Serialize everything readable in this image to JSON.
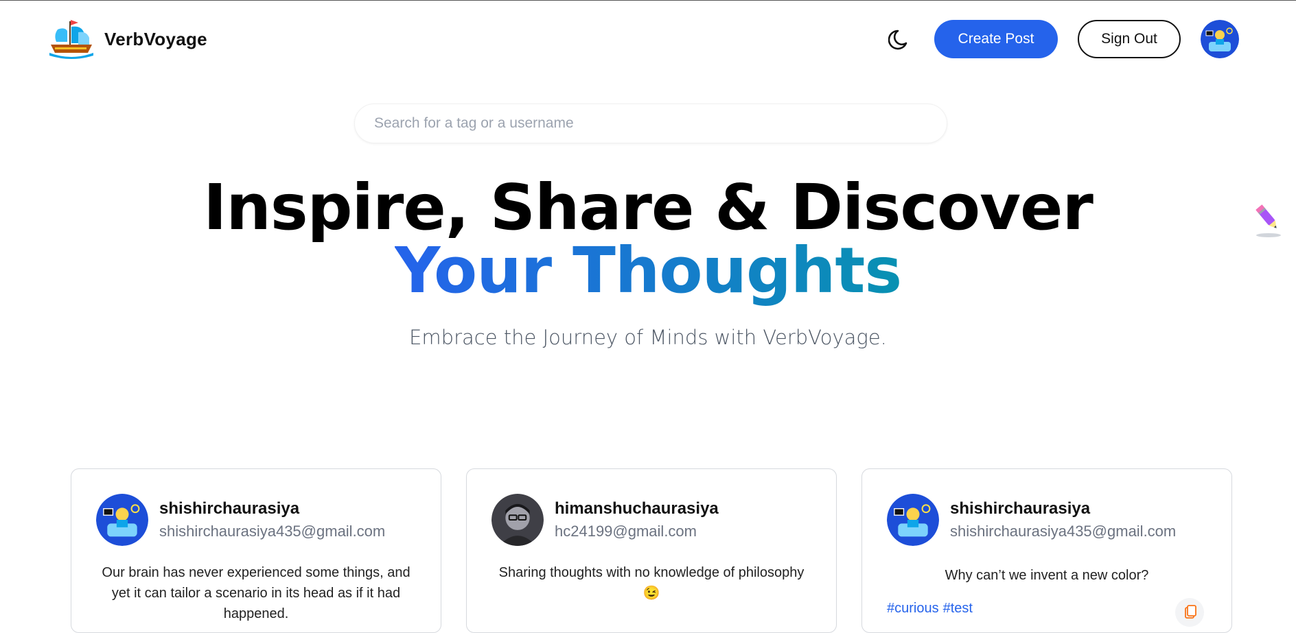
{
  "header": {
    "brand": "VerbVoyage",
    "create_label": "Create Post",
    "signout_label": "Sign Out",
    "icons": {
      "logo": "ship-icon",
      "theme": "moon-icon",
      "avatar": "user-avatar"
    }
  },
  "search": {
    "placeholder": "Search for a tag or a username",
    "value": ""
  },
  "hero": {
    "line1": "Inspire, Share & Discover",
    "line2": "Your Thoughts",
    "tagline": "Embrace the Journey of Minds with VerbVoyage.",
    "gradient": [
      "#2563eb",
      "#0891b2"
    ]
  },
  "floating_icon": "pencil-icon",
  "posts": [
    {
      "username": "shishirchaurasiya",
      "email": "shishirchaurasiya435@gmail.com",
      "text": "Our brain has never experienced some things, and yet it can tailor a scenario in its head as if it had happened.",
      "tags": []
    },
    {
      "username": "himanshuchaurasiya",
      "email": "hc24199@gmail.com",
      "text": "Sharing thoughts with no knowledge of philosophy 😉",
      "tags": []
    },
    {
      "username": "shishirchaurasiya",
      "email": "shishirchaurasiya435@gmail.com",
      "text": "Why can’t we invent a new color?",
      "tags": [
        "#curious",
        "#test"
      ]
    }
  ],
  "colors": {
    "accent": "#2563eb",
    "text": "#111111",
    "muted": "#6b7280",
    "border": "#d6d9de"
  }
}
